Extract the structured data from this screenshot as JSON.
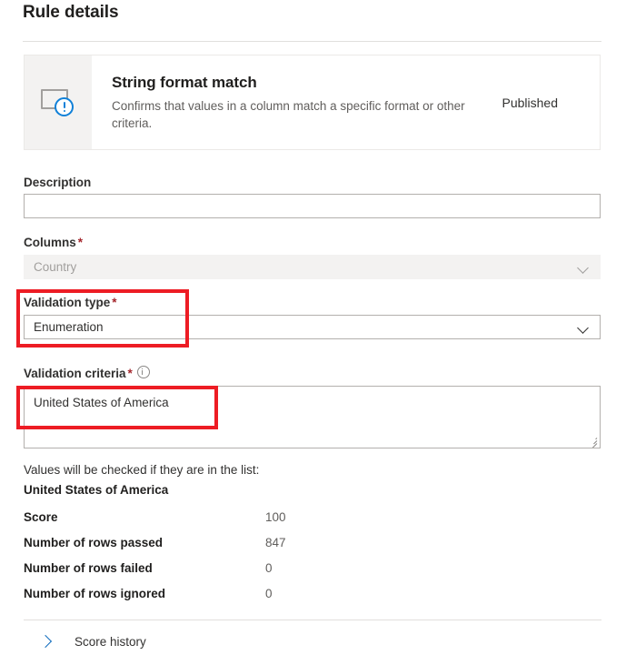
{
  "header": {
    "title": "Rule details"
  },
  "rule_card": {
    "icon": "monitor-alert-icon",
    "name": "String format match",
    "description": "Confirms that values in a column match a specific format or other criteria.",
    "status": "Published"
  },
  "form": {
    "description": {
      "label": "Description",
      "value": "",
      "placeholder": ""
    },
    "columns": {
      "label": "Columns",
      "required_marker": "*",
      "value": "Country",
      "chevron": "chevron-down-icon",
      "disabled": true
    },
    "validation_type": {
      "label": "Validation type",
      "required_marker": "*",
      "value": "Enumeration",
      "chevron": "chevron-down-icon"
    },
    "validation_criteria": {
      "label": "Validation criteria",
      "required_marker": "*",
      "info_icon": "info-icon",
      "value": "United States of America"
    }
  },
  "results": {
    "note": "Values will be checked if they are in the list:",
    "note_value": "United States of America",
    "stats": [
      {
        "label": "Score",
        "value": "100"
      },
      {
        "label": "Number of rows passed",
        "value": "847"
      },
      {
        "label": "Number of rows failed",
        "value": "0"
      },
      {
        "label": "Number of rows ignored",
        "value": "0"
      }
    ]
  },
  "footer": {
    "expander_icon": "chevron-right-icon",
    "expander_label": "Score history"
  },
  "annotations": {
    "highlight_color": "#ed1c24",
    "boxes": [
      {
        "name": "validation-type-highlight"
      },
      {
        "name": "validation-criteria-value-highlight"
      }
    ]
  }
}
